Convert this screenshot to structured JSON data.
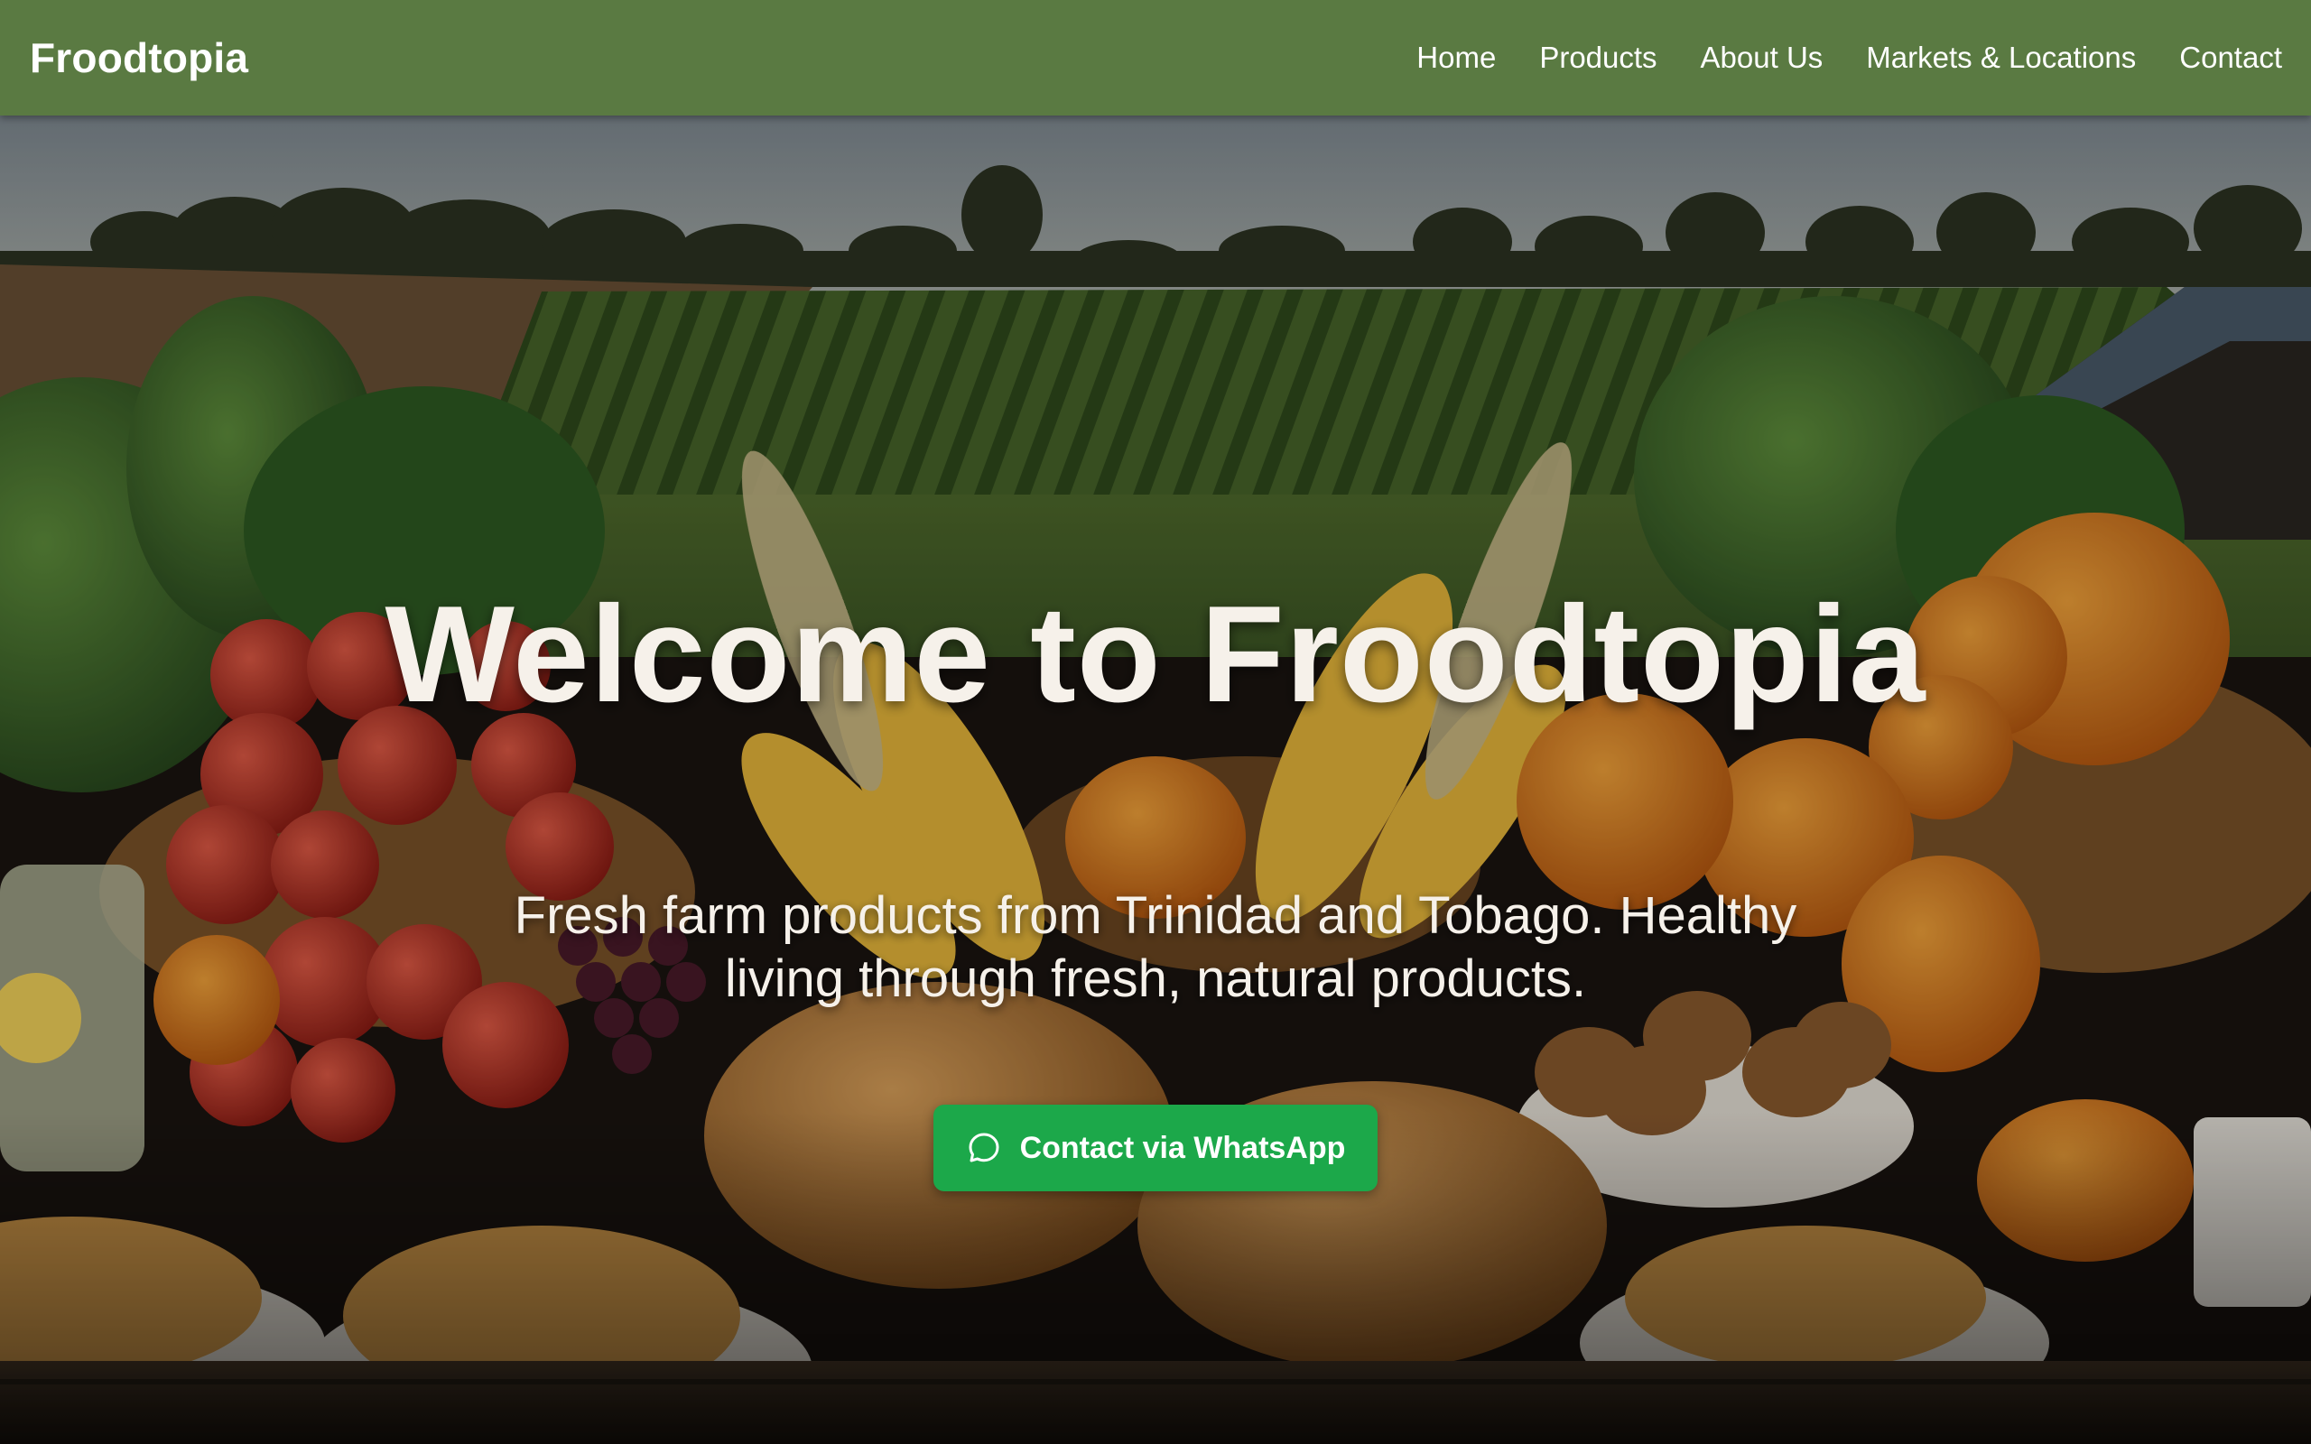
{
  "nav": {
    "brand": "Froodtopia",
    "links": [
      {
        "label": "Home"
      },
      {
        "label": "Products"
      },
      {
        "label": "About Us"
      },
      {
        "label": "Markets & Locations"
      },
      {
        "label": "Contact"
      }
    ]
  },
  "hero": {
    "title": "Welcome to Froodtopia",
    "subtitle": "Fresh farm products from Trinidad and Tobago. Healthy living through fresh, natural products.",
    "cta_label": "Contact via WhatsApp",
    "cta_icon": "whatsapp-chat-icon",
    "background": "farm-produce-table-photo"
  },
  "colors": {
    "nav_bg": "#5a7a42",
    "cta_bg": "#1ca84a",
    "hero_text": "#f6f1ea"
  }
}
